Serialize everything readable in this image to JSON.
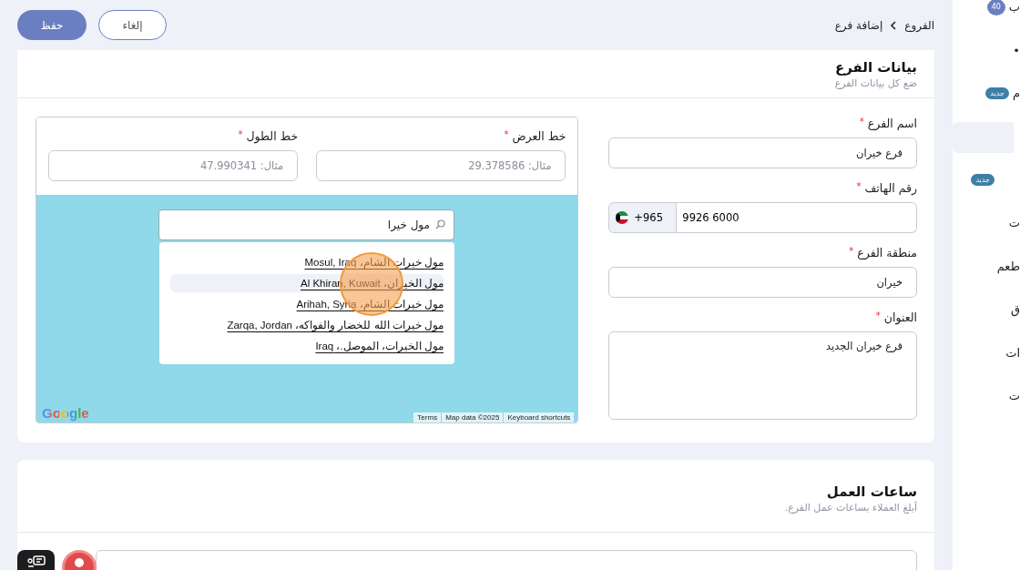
{
  "sidebar": {
    "items": [
      {
        "label": "ب",
        "badge": "40",
        "kind": "count",
        "selected": false
      },
      {
        "label": "•",
        "selected": false
      },
      {
        "label": "م",
        "badge": "جديد",
        "kind": "new",
        "selected": false
      },
      {
        "selected": true
      },
      {
        "badge": "جديد",
        "kind": "new",
        "selected": false
      },
      {
        "label": "ت",
        "selected": false
      },
      {
        "label": "طعم",
        "selected": false
      },
      {
        "label": "ق",
        "selected": false
      },
      {
        "label": "ات",
        "selected": false
      },
      {
        "label": "ت",
        "selected": false
      }
    ]
  },
  "breadcrumb": [
    {
      "label": "الفروع"
    },
    {
      "label": "إضافة فرع"
    }
  ],
  "buttons": [
    {
      "kind": "secondary",
      "label": "إلغاء"
    },
    {
      "kind": "primary",
      "label": "حفظ"
    }
  ],
  "branch_card": {
    "title": "بيانات الفرع",
    "subtitle": "ضع كل بيانات الفرع",
    "fields": [
      {
        "kind": "text",
        "label": "اسم الفرع",
        "required_mark": "*",
        "value": "فرع خيران"
      },
      {
        "kind": "phone",
        "label": "رقم الهاتف",
        "required_mark": "*",
        "country_code": "+965",
        "value": "9926 6000"
      },
      {
        "kind": "text",
        "label": "منطقة الفرع",
        "required_mark": "*",
        "value": "خيران"
      },
      {
        "kind": "textarea",
        "label": "العنوان",
        "required_mark": "*",
        "value": "فرع خيران الجديد"
      }
    ],
    "coordinates": [
      {
        "label": "خط العرض",
        "required_mark": "*",
        "placeholder": "مثال: 29.378586"
      },
      {
        "label": "خط الطول",
        "required_mark": "*",
        "placeholder": "مثال: 47.990341"
      }
    ],
    "map": {
      "search_value": "مول خيرا",
      "suggestions": [
        {
          "text": "مول خيرات الشام، Mosul, Iraq",
          "selected": false
        },
        {
          "text": "مول الخيران، Al Khiran, Kuwait",
          "selected": true
        },
        {
          "text": "مول خيرات الشام، Arihah, Syria",
          "selected": false
        },
        {
          "text": "مول خيرات الله للخضار والفواكه، Zarqa, Jordan",
          "selected": false
        },
        {
          "text": "مول الخيرات، الموصل.، Iraq",
          "selected": false
        }
      ],
      "logo": "Google",
      "attribution": [
        "Keyboard shortcuts",
        "Map data ©2025",
        "Terms"
      ]
    }
  },
  "hours_card": {
    "title": "ساعات العمل",
    "subtitle": "أبلغ العملاء بساعات عمل الفرع."
  }
}
